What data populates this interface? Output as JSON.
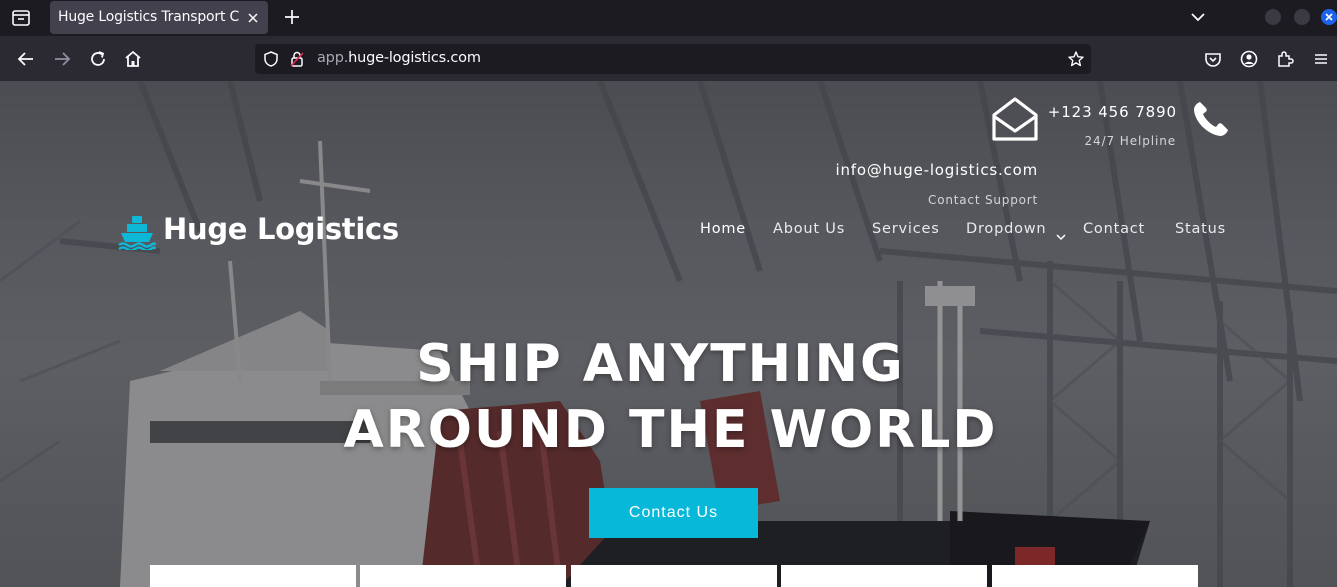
{
  "browser": {
    "tab_title": "Huge Logistics Transport Cat",
    "url_host_prefix": "app.",
    "url_host_main": "huge-logistics.com"
  },
  "header": {
    "email": "info@huge-logistics.com",
    "email_caption": "Contact Support",
    "phone": "+123 456 7890",
    "phone_caption": "24/7 Helpline"
  },
  "brand": {
    "name": "Huge Logistics",
    "icon": "ship-icon",
    "accent": "#0fb7d6"
  },
  "nav": {
    "items": [
      "Home",
      "About Us",
      "Services",
      "Dropdown",
      "Contact",
      "Status"
    ],
    "active": "Home"
  },
  "hero": {
    "line1": "SHIP ANYTHING",
    "line2": "AROUND THE WORLD",
    "cta_label": "Contact Us",
    "cta_color": "#07b8d8"
  }
}
